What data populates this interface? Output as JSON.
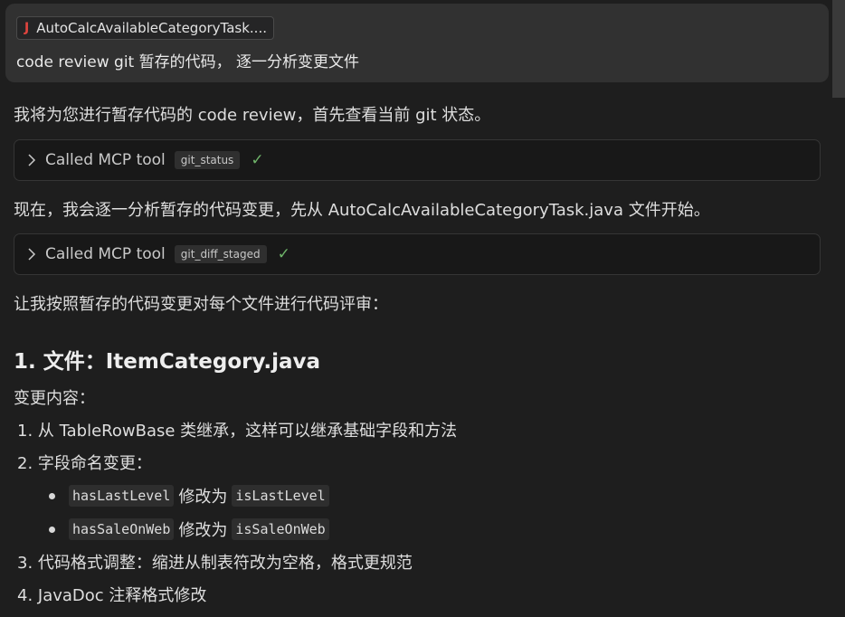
{
  "user_message": {
    "attachment": {
      "icon": "java-file-icon",
      "icon_glyph": "J",
      "name": "AutoCalcAvailableCategoryTask...."
    },
    "text": "code review git 暂存的代码， 逐一分析变更文件"
  },
  "assistant": {
    "intro": "我将为您进行暂存代码的 code review，首先查看当前 git 状态。",
    "tool_calls": [
      {
        "label": "Called MCP tool",
        "tool": "git_status",
        "status": "success"
      },
      {
        "label": "Called MCP tool",
        "tool": "git_diff_staged",
        "status": "success"
      }
    ],
    "analysis_line": "现在，我会逐一分析暂存的代码变更，先从 AutoCalcAvailableCategoryTask.java 文件开始。",
    "review_intro": "让我按照暂存的代码变更对每个文件进行代码评审：",
    "section": {
      "heading": "1. 文件：ItemCategory.java",
      "change_label": "变更内容：",
      "items": [
        "1. 从 TableRowBase 类继承，这样可以继承基础字段和方法",
        "2. 字段命名变更：",
        "3. 代码格式调整：缩进从制表符改为空格，格式更规范",
        "4. JavaDoc 注释格式修改"
      ],
      "renames": [
        {
          "from": "hasLastLevel",
          "verb": "修改为",
          "to": "isLastLevel"
        },
        {
          "from": "hasSaleOnWeb",
          "verb": "修改为",
          "to": "isSaleOnWeb"
        }
      ]
    }
  }
}
